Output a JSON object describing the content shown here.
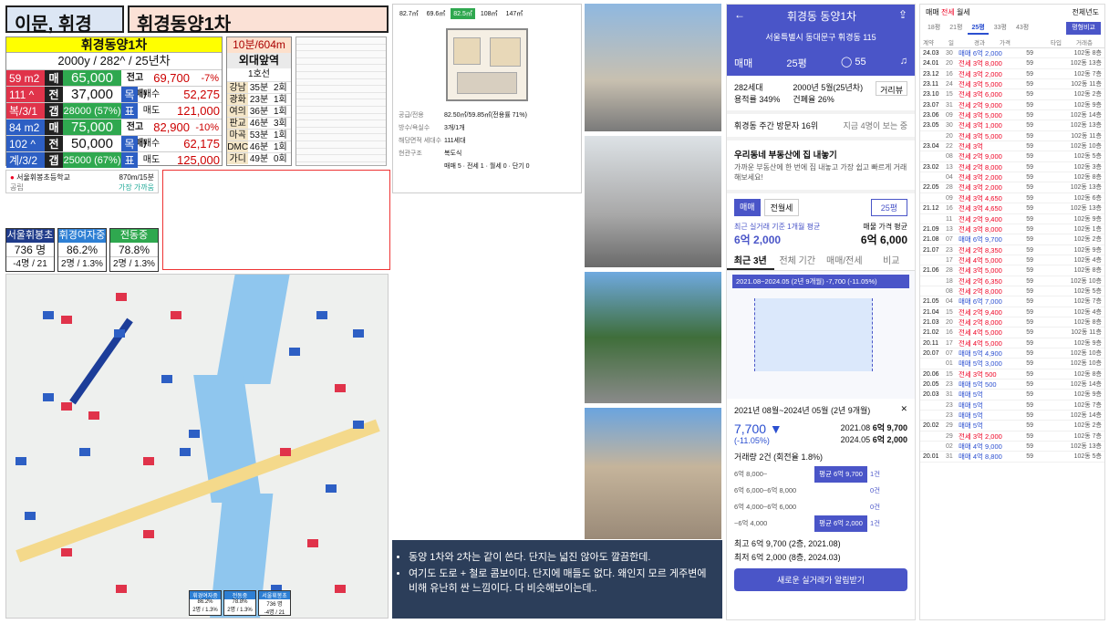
{
  "header": {
    "region": "이문, 휘경",
    "complex": "휘경동양1차"
  },
  "summary": {
    "title": "휘경동양1차",
    "sub": "2000y / 282^ / 25년차",
    "units": [
      {
        "size": "59 m2",
        "info1": "111 ^",
        "info2": "복/3/1",
        "sale_lbl": "매",
        "sale": "65,000",
        "high_lbl": "전고(매매)",
        "high": "69,700",
        "pct": "-7%",
        "rent_lbl": "전",
        "rent": "37,000",
        "gap_lbl": "갭",
        "gap": "28000 (57%)",
        "m1": "목",
        "m1l": "매수",
        "m1v": "52,275",
        "m2": "표",
        "m2l": "매도",
        "m2v": "121,000"
      },
      {
        "size": "84 m2",
        "info1": "102 ^",
        "info2": "계/3/2",
        "sale_lbl": "매",
        "sale": "75,000",
        "high_lbl": "전고(매매)",
        "high": "82,900",
        "pct": "-10%",
        "rent_lbl": "전",
        "rent": "50,000",
        "gap_lbl": "갭",
        "gap": "25000 (67%)",
        "m1": "목",
        "m1l": "매수",
        "m1v": "62,175",
        "m2": "표",
        "m2l": "매도",
        "m2v": "125,000"
      }
    ]
  },
  "commute": {
    "head": "10분/604m",
    "title": "외대앞역",
    "sub": "1호선",
    "rows": [
      [
        "강남",
        "35분",
        "2회"
      ],
      [
        "광화문",
        "23분",
        "1회"
      ],
      [
        "여의도",
        "36분",
        "1회"
      ],
      [
        "판교",
        "46분",
        "3회"
      ],
      [
        "마곡나루",
        "53분",
        "1회"
      ],
      [
        "DMC",
        "46분",
        "1회"
      ],
      [
        "가디",
        "49분",
        "0회"
      ]
    ]
  },
  "school": {
    "name": "서울휘봉초등학교",
    "dist": "870m/15분",
    "type": "공립",
    "tag": "가장 가까움"
  },
  "stats": [
    {
      "name": "서울휘봉초",
      "value": "736 명",
      "delta": "-4명 / 21",
      "color": "#1f3b8a"
    },
    {
      "name": "휘경여자중",
      "value": "86.2%",
      "delta": "2명 / 1.3%",
      "color": "#2d7fd4"
    },
    {
      "name": "전동중",
      "value": "78.8%",
      "delta": "2명 / 1.3%",
      "color": "#2fa84f"
    }
  ],
  "map_legend": [
    {
      "name": "휘경여자중",
      "value": "86.2%",
      "delta": "2명 / 1.3%"
    },
    {
      "name": "전동중",
      "value": "78.8%",
      "delta": "2명 / 1.3%"
    },
    {
      "name": "서울휘봉초",
      "value": "736 명",
      "delta": "-4명 / 21"
    }
  ],
  "listing": {
    "tabs": [
      "82.7㎡",
      "69.6㎡",
      "82.5㎡",
      "108㎡",
      "147㎡"
    ],
    "info": [
      [
        "공급/전용",
        "82.50㎡/59.85㎡(전용률 71%)"
      ],
      [
        "방수/욕실수",
        "3개/1개"
      ],
      [
        "해당면적 세대수",
        "111세대"
      ],
      [
        "현관구조",
        "복도식"
      ],
      [
        "",
        "매매 5 · 전세 1 · 월세 0 · 단기 0"
      ]
    ]
  },
  "note": {
    "lines": [
      "동양 1차와 2차는 같이 쓴다. 단지는 넓진 않아도 깔끔한데.",
      "여기도 도로 + 철로 콤보이다. 단지에 매들도 없다. 왜인지 모르 게주변에 비해 유난히 싼 느낌이다. 다 비슷해보이는데.."
    ]
  },
  "app": {
    "title": "휘경동 동양1차",
    "address": "서울특별시 동대문구 휘경동 115",
    "type": "매매",
    "size": "25평",
    "comments": "55",
    "households": "282세대",
    "built": "2000년 5월(25년차)",
    "far": "용적률 349%",
    "bcr": "건폐율 26%",
    "distance_btn": "거리뷰",
    "visitors": "휘경동 주간 방문자 16위",
    "visitors_more": "지금 4명이 보는 중",
    "promo_title": "우리동네 부동산에 집 내놓기",
    "promo_text": "가까운 부동산에 한 번에 집 내놓고 가장 쉽고 빠르게 거래해보세요!",
    "tabs2": [
      "매매",
      "전월세"
    ],
    "size2": "25평",
    "recent_label": "최근 실거래 기준 1개월 평균",
    "recent_value": "6억 2,000",
    "ask_label": "매물 가격 평균",
    "ask_value": "6억 6,000",
    "period_tabs": [
      "최근 3년",
      "전체 기간",
      "매매/전세",
      "비교"
    ],
    "chart_range": "2021.08~2024.05 (2년 9개월)  -7,700 (-11.05%)",
    "panel_title": "2021년 08월~2024년 05월 (2년 9개월)",
    "drop": "7,700 ▼",
    "drop_pct": "(-11.05%)",
    "d1": "2021.08",
    "v1": "6억 9,700",
    "d2": "2024.05",
    "v2": "6억 2,000",
    "volume": "거래량 2건 (회전율 1.8%)",
    "bands": [
      {
        "label": "6억 8,000~",
        "bar": "평균 6억 9,700",
        "cnt": "1건"
      },
      {
        "label": "6억 6,000~6억 8,000",
        "bar": "",
        "cnt": "0건"
      },
      {
        "label": "6억 4,000~6억 6,000",
        "bar": "",
        "cnt": "0건"
      },
      {
        "label": "~6억 4,000",
        "bar": "평균 6억 2,000",
        "cnt": "1건"
      }
    ],
    "hi": "최고 6억 9,700 (2층, 2021.08)",
    "lo": "최저 6억 2,000 (8층, 2024.03)",
    "alert_btn": "새로운 실거래가 알림받기"
  },
  "trades": {
    "tabs": [
      "매매",
      "전세",
      "월세"
    ],
    "year_filter": "전체년도",
    "sizes": [
      "18평",
      "21평",
      "25평",
      "33평",
      "43평"
    ],
    "compare_btn": "평형비교",
    "columns": [
      "계약",
      "일",
      "경과",
      "가격",
      "타입",
      "거래층"
    ],
    "rows": [
      [
        "24.03",
        "30",
        "매매 6억 2,000",
        "59",
        "102동 8층",
        "b"
      ],
      [
        "24.01",
        "20",
        "전세 3억 8,000",
        "59",
        "102동 13층",
        "r"
      ],
      [
        "23.12",
        "16",
        "전세 3억 2,000",
        "59",
        "102동 7층",
        "r"
      ],
      [
        "23.11",
        "24",
        "전세 3억 5,000",
        "59",
        "102동 11층",
        "r"
      ],
      [
        "23.10",
        "15",
        "전세 3억 6,000",
        "59",
        "102동 2층",
        "r"
      ],
      [
        "23.07",
        "31",
        "전세 2억 9,000",
        "59",
        "102동 9층",
        "r"
      ],
      [
        "23.06",
        "09",
        "전세 3억 5,000",
        "59",
        "102동 14층",
        "r"
      ],
      [
        "23.05",
        "30",
        "전세 3억 1,000",
        "59",
        "102동 13층",
        "r"
      ],
      [
        "",
        "20",
        "전세 3억 5,000",
        "59",
        "102동 11층",
        "r"
      ],
      [
        "23.04",
        "22",
        "전세 3억",
        "59",
        "102동 10층",
        "r"
      ],
      [
        "",
        "08",
        "전세 2억 9,000",
        "59",
        "102동 5층",
        "r"
      ],
      [
        "23.02",
        "13",
        "전세 2억 8,000",
        "59",
        "102동 3층",
        "r"
      ],
      [
        "",
        "04",
        "전세 3억 2,000",
        "59",
        "102동 8층",
        "r"
      ],
      [
        "22.05",
        "28",
        "전세 3억 2,000",
        "59",
        "102동 13층",
        "r"
      ],
      [
        "",
        "09",
        "전세 3억 4,650",
        "59",
        "102동 6층",
        "r"
      ],
      [
        "21.12",
        "16",
        "전세 3억 4,650",
        "59",
        "102동 13층",
        "r"
      ],
      [
        "",
        "11",
        "전세 2억 9,400",
        "59",
        "102동 9층",
        "r"
      ],
      [
        "21.09",
        "13",
        "전세 3억 8,000",
        "59",
        "102동 1층",
        "r"
      ],
      [
        "21.08",
        "07",
        "매매 6억 9,700",
        "59",
        "102동 2층",
        "b"
      ],
      [
        "21.07",
        "23",
        "전세 2억 8,350",
        "59",
        "102동 9층",
        "r"
      ],
      [
        "",
        "17",
        "전세 4억 5,000",
        "59",
        "102동 4층",
        "r"
      ],
      [
        "21.06",
        "28",
        "전세 3억 5,000",
        "59",
        "102동 8층",
        "r"
      ],
      [
        "",
        "18",
        "전세 2억 6,350",
        "59",
        "102동 10층",
        "r"
      ],
      [
        "",
        "08",
        "전세 2억 8,000",
        "59",
        "102동 5층",
        "r"
      ],
      [
        "21.05",
        "04",
        "매매 6억 7,000",
        "59",
        "102동 7층",
        "b"
      ],
      [
        "21.04",
        "15",
        "전세 2억 9,400",
        "59",
        "102동 4층",
        "r"
      ],
      [
        "21.03",
        "20",
        "전세 2억 8,000",
        "59",
        "102동 8층",
        "r"
      ],
      [
        "21.02",
        "16",
        "전세 4억 5,000",
        "59",
        "102동 11층",
        "r"
      ],
      [
        "20.11",
        "17",
        "전세 4억 5,000",
        "59",
        "102동 9층",
        "r"
      ],
      [
        "20.07",
        "07",
        "매매 5억 4,900",
        "59",
        "102동 10층",
        "b"
      ],
      [
        "",
        "01",
        "매매 5억 3,000",
        "59",
        "102동 10층",
        "b"
      ],
      [
        "20.06",
        "15",
        "전세 3억 500",
        "59",
        "102동 8층",
        "r"
      ],
      [
        "20.05",
        "23",
        "매매 5억 500",
        "59",
        "102동 14층",
        "b"
      ],
      [
        "20.03",
        "31",
        "매매 5억",
        "59",
        "102동 9층",
        "b"
      ],
      [
        "",
        "23",
        "매매 5억",
        "59",
        "102동 7층",
        "b"
      ],
      [
        "",
        "23",
        "매매 5억",
        "59",
        "102동 14층",
        "b"
      ],
      [
        "20.02",
        "29",
        "매매 5억",
        "59",
        "102동 2층",
        "b"
      ],
      [
        "",
        "29",
        "전세 3억 2,000",
        "59",
        "102동 7층",
        "r"
      ],
      [
        "",
        "02",
        "매매 4억 9,000",
        "59",
        "102동 13층",
        "b"
      ],
      [
        "20.01",
        "31",
        "매매 4억 8,800",
        "59",
        "102동 5층",
        "b"
      ]
    ]
  }
}
